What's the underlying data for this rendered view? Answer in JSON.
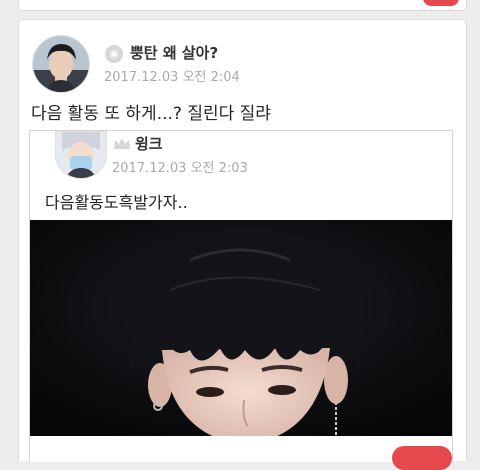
{
  "post": {
    "author": "뿡탄 왜 살아?",
    "date": "2017.12.03 오전 2:04",
    "text": "다음 활동 또 하게...? 질린다 질랴",
    "avatar": "avatar-photo",
    "level_icon": "level-badge-icon"
  },
  "quoted_post": {
    "author": "윙크",
    "date": "2017.12.03 오전 2:03",
    "text": "다음활동도흑발가자..",
    "avatar": "avatar-photo",
    "level_icon": "crown-icon",
    "image": "photo-dark-hair-person"
  },
  "colors": {
    "background": "#ececec",
    "card": "#ffffff",
    "date_text": "#aaaaaa",
    "badge": "#e5484d"
  }
}
